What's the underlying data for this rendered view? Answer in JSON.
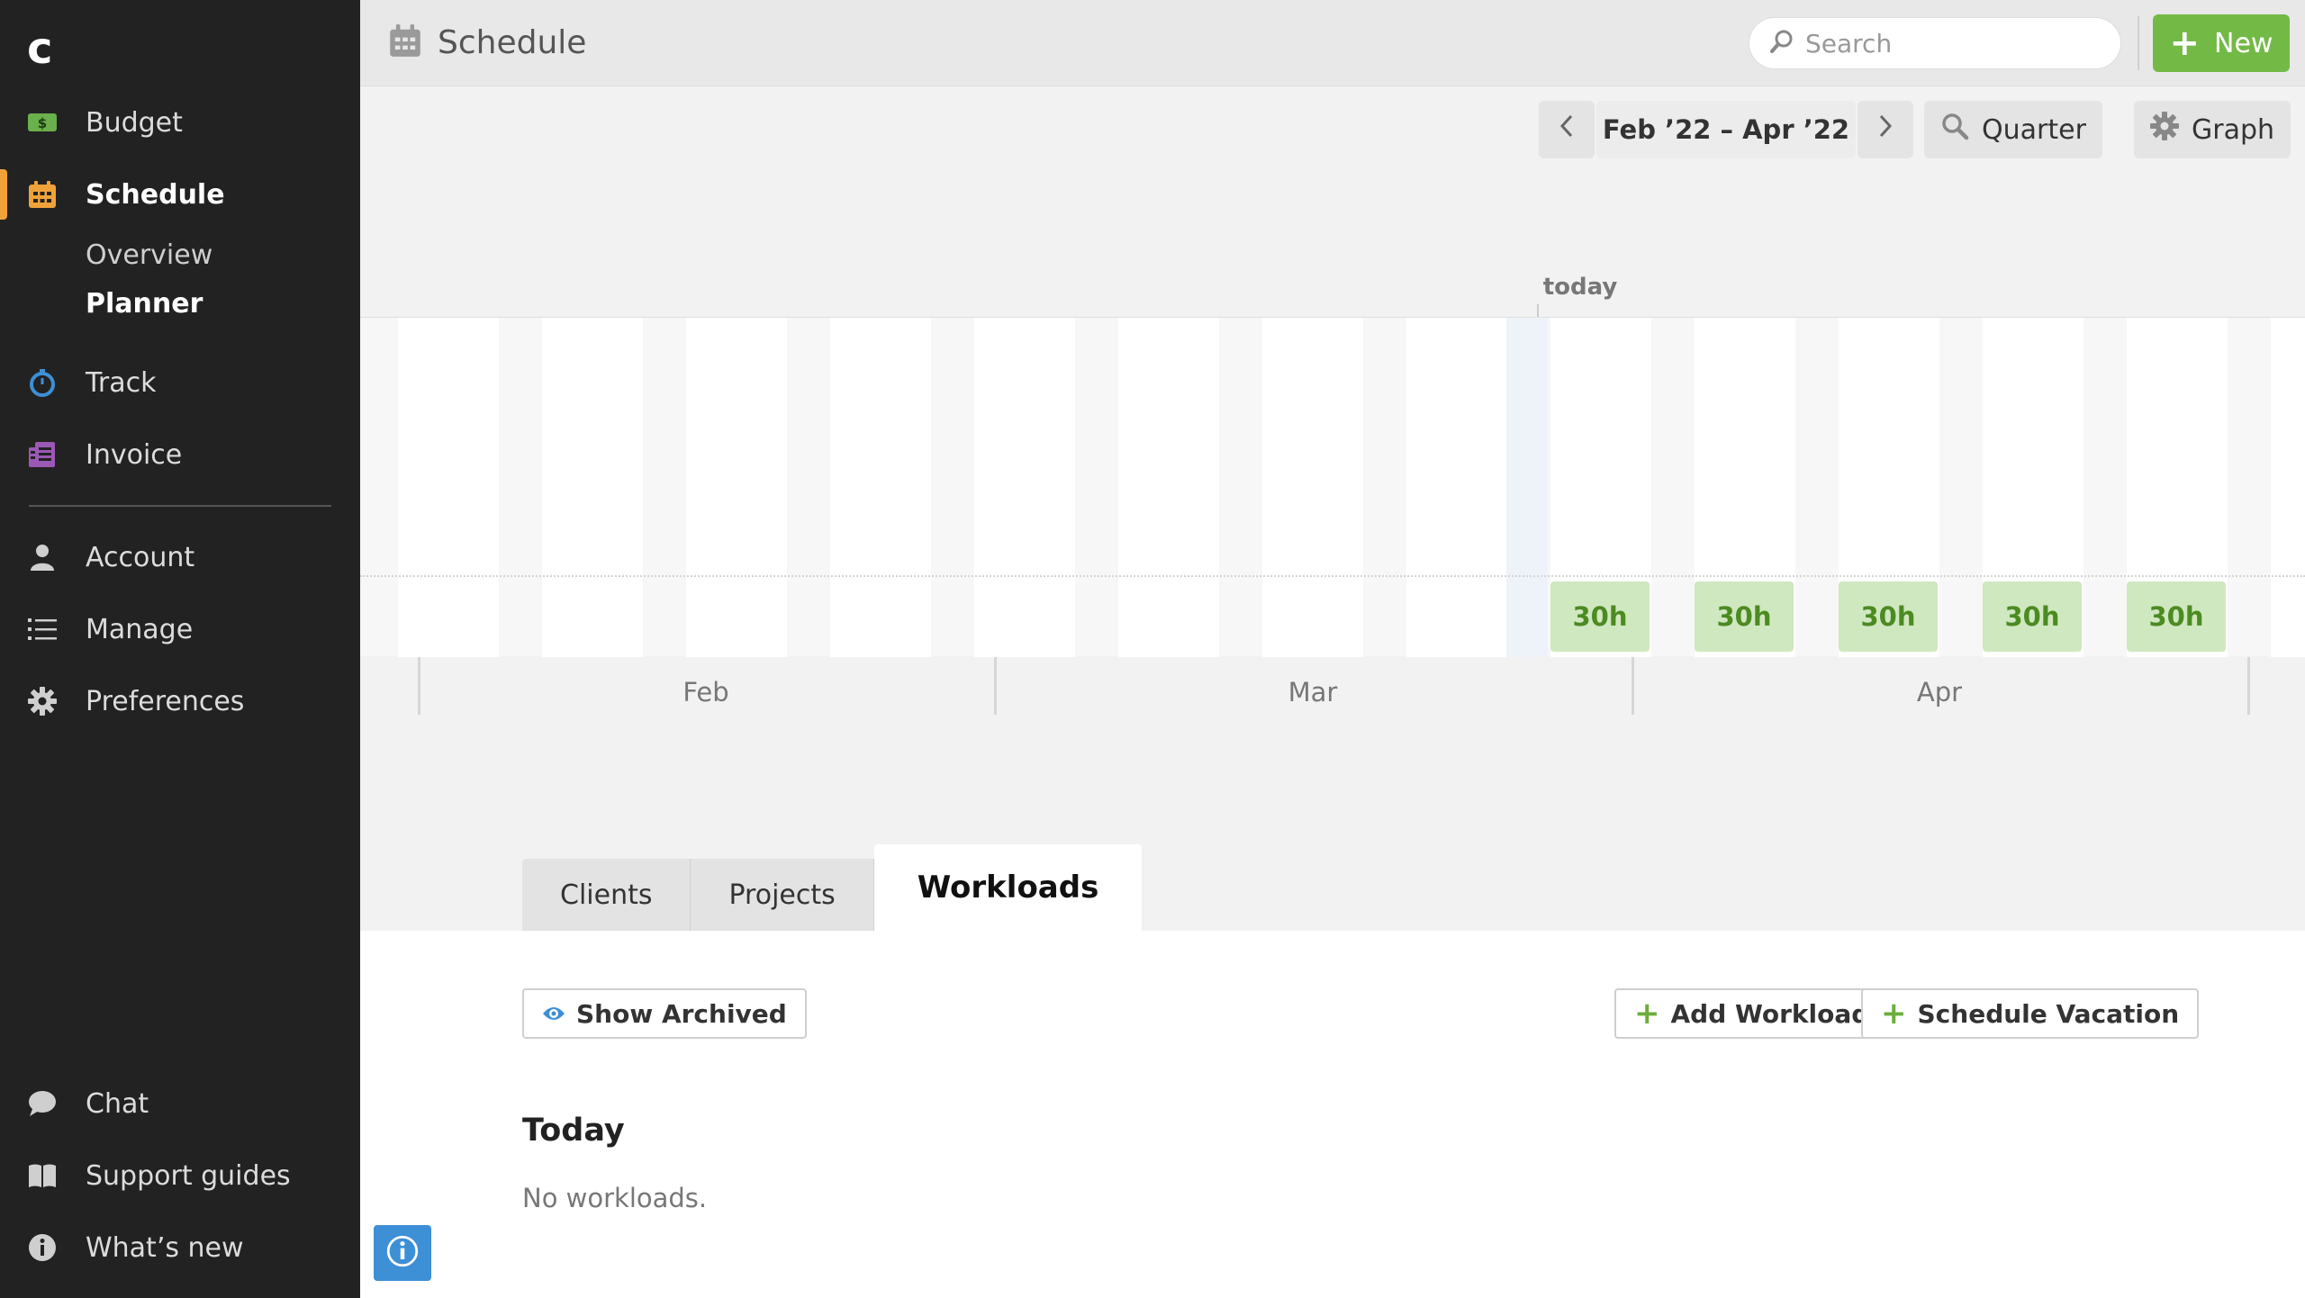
{
  "sidebar": {
    "logo": "c",
    "items": [
      {
        "label": "Budget",
        "icon": "money-icon",
        "color": "#6ab04c"
      },
      {
        "label": "Schedule",
        "icon": "calendar-icon",
        "color": "#f0a23a",
        "active": true
      },
      {
        "label": "Track",
        "icon": "stopwatch-icon",
        "color": "#3d8fd6"
      },
      {
        "label": "Invoice",
        "icon": "invoice-icon",
        "color": "#9b59b6"
      },
      {
        "label": "Account",
        "icon": "person-icon"
      },
      {
        "label": "Manage",
        "icon": "list-icon"
      },
      {
        "label": "Preferences",
        "icon": "gear-icon"
      }
    ],
    "schedule_sub": [
      "Overview",
      "Planner"
    ],
    "bottom": [
      {
        "label": "Chat",
        "icon": "chat-bubble-icon"
      },
      {
        "label": "Support guides",
        "icon": "book-icon"
      },
      {
        "label": "What’s new",
        "icon": "info-icon"
      }
    ]
  },
  "header": {
    "title": "Schedule",
    "search_placeholder": "Search",
    "new_label": "New"
  },
  "toolbar": {
    "date_range": "Feb ’22 – Apr ’22",
    "zoom_label": "Quarter",
    "view_label": "Graph"
  },
  "timeline": {
    "today_label": "today",
    "months": [
      "Feb",
      "Mar",
      "Apr"
    ],
    "hours": [
      "30h",
      "30h",
      "30h",
      "30h",
      "30h"
    ]
  },
  "tabs": [
    "Clients",
    "Projects",
    "Workloads"
  ],
  "content": {
    "show_archived": "Show Archived",
    "add_workload": "Add Workload",
    "schedule_vacation": "Schedule Vacation",
    "section_title": "Today",
    "empty_text": "No workloads."
  },
  "colors": {
    "accent_green": "#73b946",
    "hours_bg": "#cfe8bf",
    "active_indicator": "#f0a23a",
    "info_blue": "#3d8fd6"
  }
}
